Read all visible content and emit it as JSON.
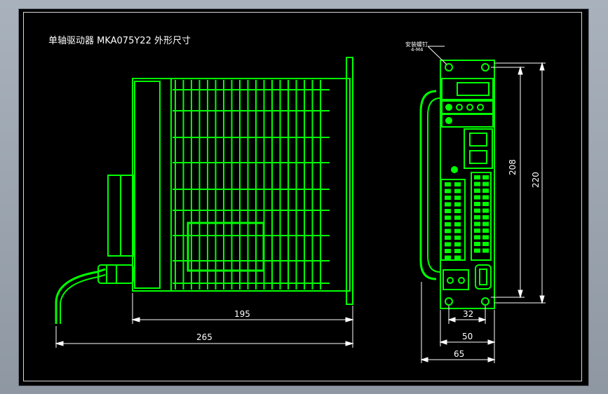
{
  "drawing": {
    "title": "单轴驱动器 MKA075Y22 外形尺寸",
    "mount_note_line1": "安装螺钉",
    "mount_note_line2": "4-M4",
    "colors": {
      "background": "#000000",
      "outline": "#00ff00",
      "dimension": "#ffffff",
      "panel_frame": "#a9b2bc"
    }
  },
  "dimensions": {
    "side_width": "195",
    "side_total_width": "265",
    "front_height_inner": "208",
    "front_height_outer": "220",
    "front_hole_spacing": "32",
    "front_body_width": "50",
    "front_total_width": "65"
  }
}
